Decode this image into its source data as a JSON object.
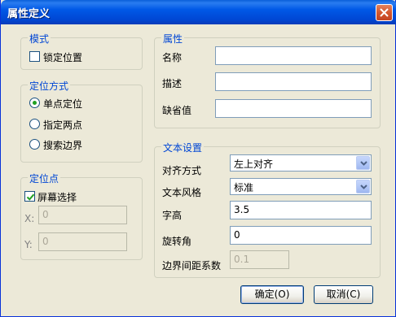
{
  "dialog": {
    "title": "属性定义",
    "close_label": "X"
  },
  "mode": {
    "legend": "模式",
    "lock_position": {
      "label": "锁定位置",
      "checked": false
    }
  },
  "positioning": {
    "legend": "定位方式",
    "options": [
      {
        "label": "单点定位",
        "selected": true
      },
      {
        "label": "指定两点",
        "selected": false
      },
      {
        "label": "搜索边界",
        "selected": false
      }
    ]
  },
  "anchor": {
    "legend": "定位点",
    "screen_select": {
      "label": "屏幕选择",
      "checked": true
    },
    "x": {
      "label": "X:",
      "value": "0"
    },
    "y": {
      "label": "Y:",
      "value": "0"
    }
  },
  "attributes": {
    "legend": "属性",
    "name": {
      "label": "名称",
      "value": ""
    },
    "description": {
      "label": "描述",
      "value": ""
    },
    "default_value": {
      "label": "缺省值",
      "value": ""
    }
  },
  "text_settings": {
    "legend": "文本设置",
    "alignment": {
      "label": "对齐方式",
      "value": "左上对齐"
    },
    "text_style": {
      "label": "文本风格",
      "value": "标准"
    },
    "height": {
      "label": "字高",
      "value": "3.5"
    },
    "rotation": {
      "label": "旋转角",
      "value": "0"
    },
    "boundary_spacing": {
      "label": "边界间距系数",
      "value": "0.1"
    }
  },
  "buttons": {
    "ok": "确定(O)",
    "cancel": "取消(C)"
  }
}
